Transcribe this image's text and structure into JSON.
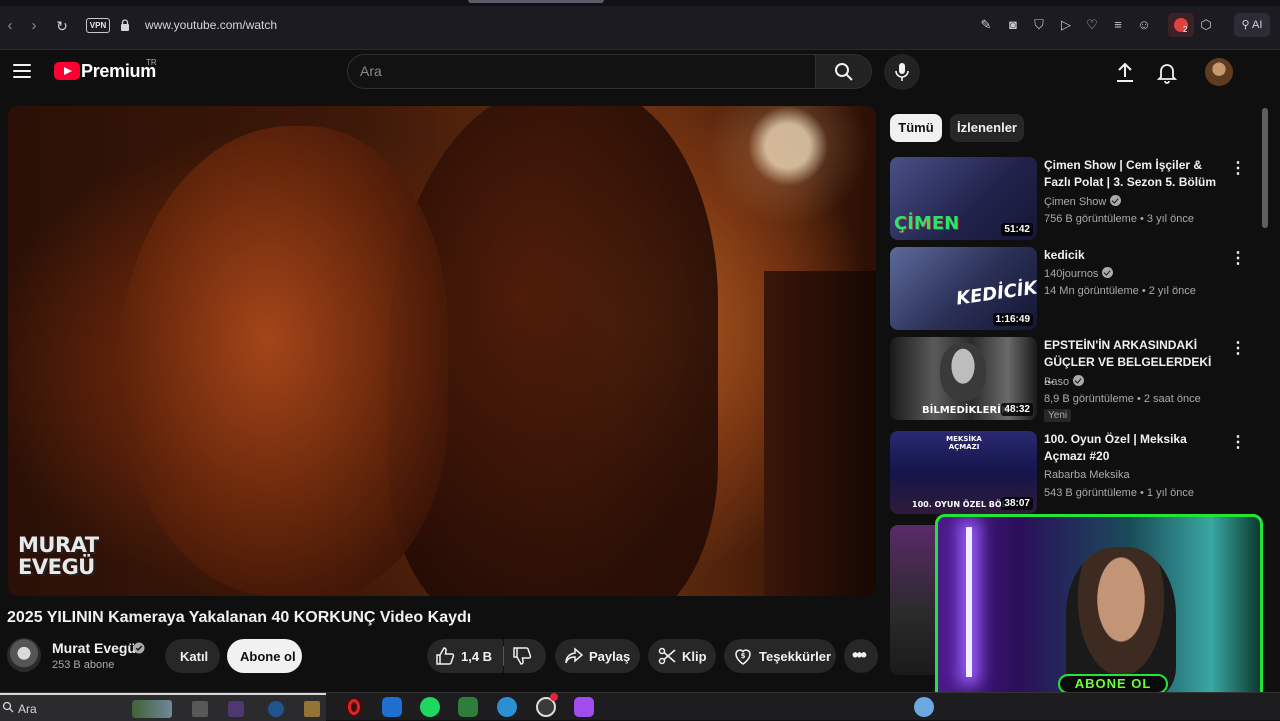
{
  "browser": {
    "url": "www.youtube.com/watch",
    "vpn_label": "VPN",
    "ai_label": "AI",
    "ext_badge": "2"
  },
  "header": {
    "brand": "Premium",
    "region": "TR",
    "search_placeholder": "Ara"
  },
  "video": {
    "watermark_line1": "MURAT",
    "watermark_line2": "EVEGÜ",
    "title": "2025 YILININ Kameraya Yakalanan 40 KORKUNÇ Video Kaydı",
    "channel_name": "Murat Evegü",
    "subscribers": "253 B abone",
    "join_label": "Katıl",
    "subscribe_label": "Abone ol",
    "like_count": "1,4 B",
    "share_label": "Paylaş",
    "clip_label": "Klip",
    "thanks_label": "Teşekkürler"
  },
  "filters": [
    "Tümü",
    "İzlenenler"
  ],
  "recommendations": [
    {
      "title": "Çimen Show | Cem İşçiler & Fazlı Polat | 3. Sezon 5. Bölüm",
      "channel": "Çimen Show",
      "meta": "756 B görüntüleme • 3 yıl önce",
      "duration": "51:42",
      "thumb_text": "ÇİMEN",
      "verified": true
    },
    {
      "title": "kedicik",
      "channel": "140journos",
      "meta": "14 Mn görüntüleme • 2 yıl önce",
      "duration": "1:16:49",
      "thumb_text": "KEDİCİK",
      "verified": true
    },
    {
      "title": "EPSTEİN'İN ARKASINDAKİ GÜÇLER VE BELGELERDEKİ ...",
      "channel": "Baso",
      "meta": "8,9 B görüntüleme • 2 saat önce",
      "duration": "48:32",
      "thumb_text": "BİLMEDİKLERİN",
      "badge": "Yeni",
      "verified": true
    },
    {
      "title": "100. Oyun Özel | Meksika Açmazı #20",
      "channel": "Rabarba Meksika",
      "meta": "543 B görüntüleme • 1 yıl önce",
      "duration": "38:07",
      "thumb_text": "100. OYUN ÖZEL BÖL",
      "thumb_title": "MEKSİKA AÇMAZI",
      "verified": false
    }
  ],
  "overlay": {
    "banner": "ABONE OL"
  },
  "taskbar": {
    "search_label": "Ara"
  }
}
